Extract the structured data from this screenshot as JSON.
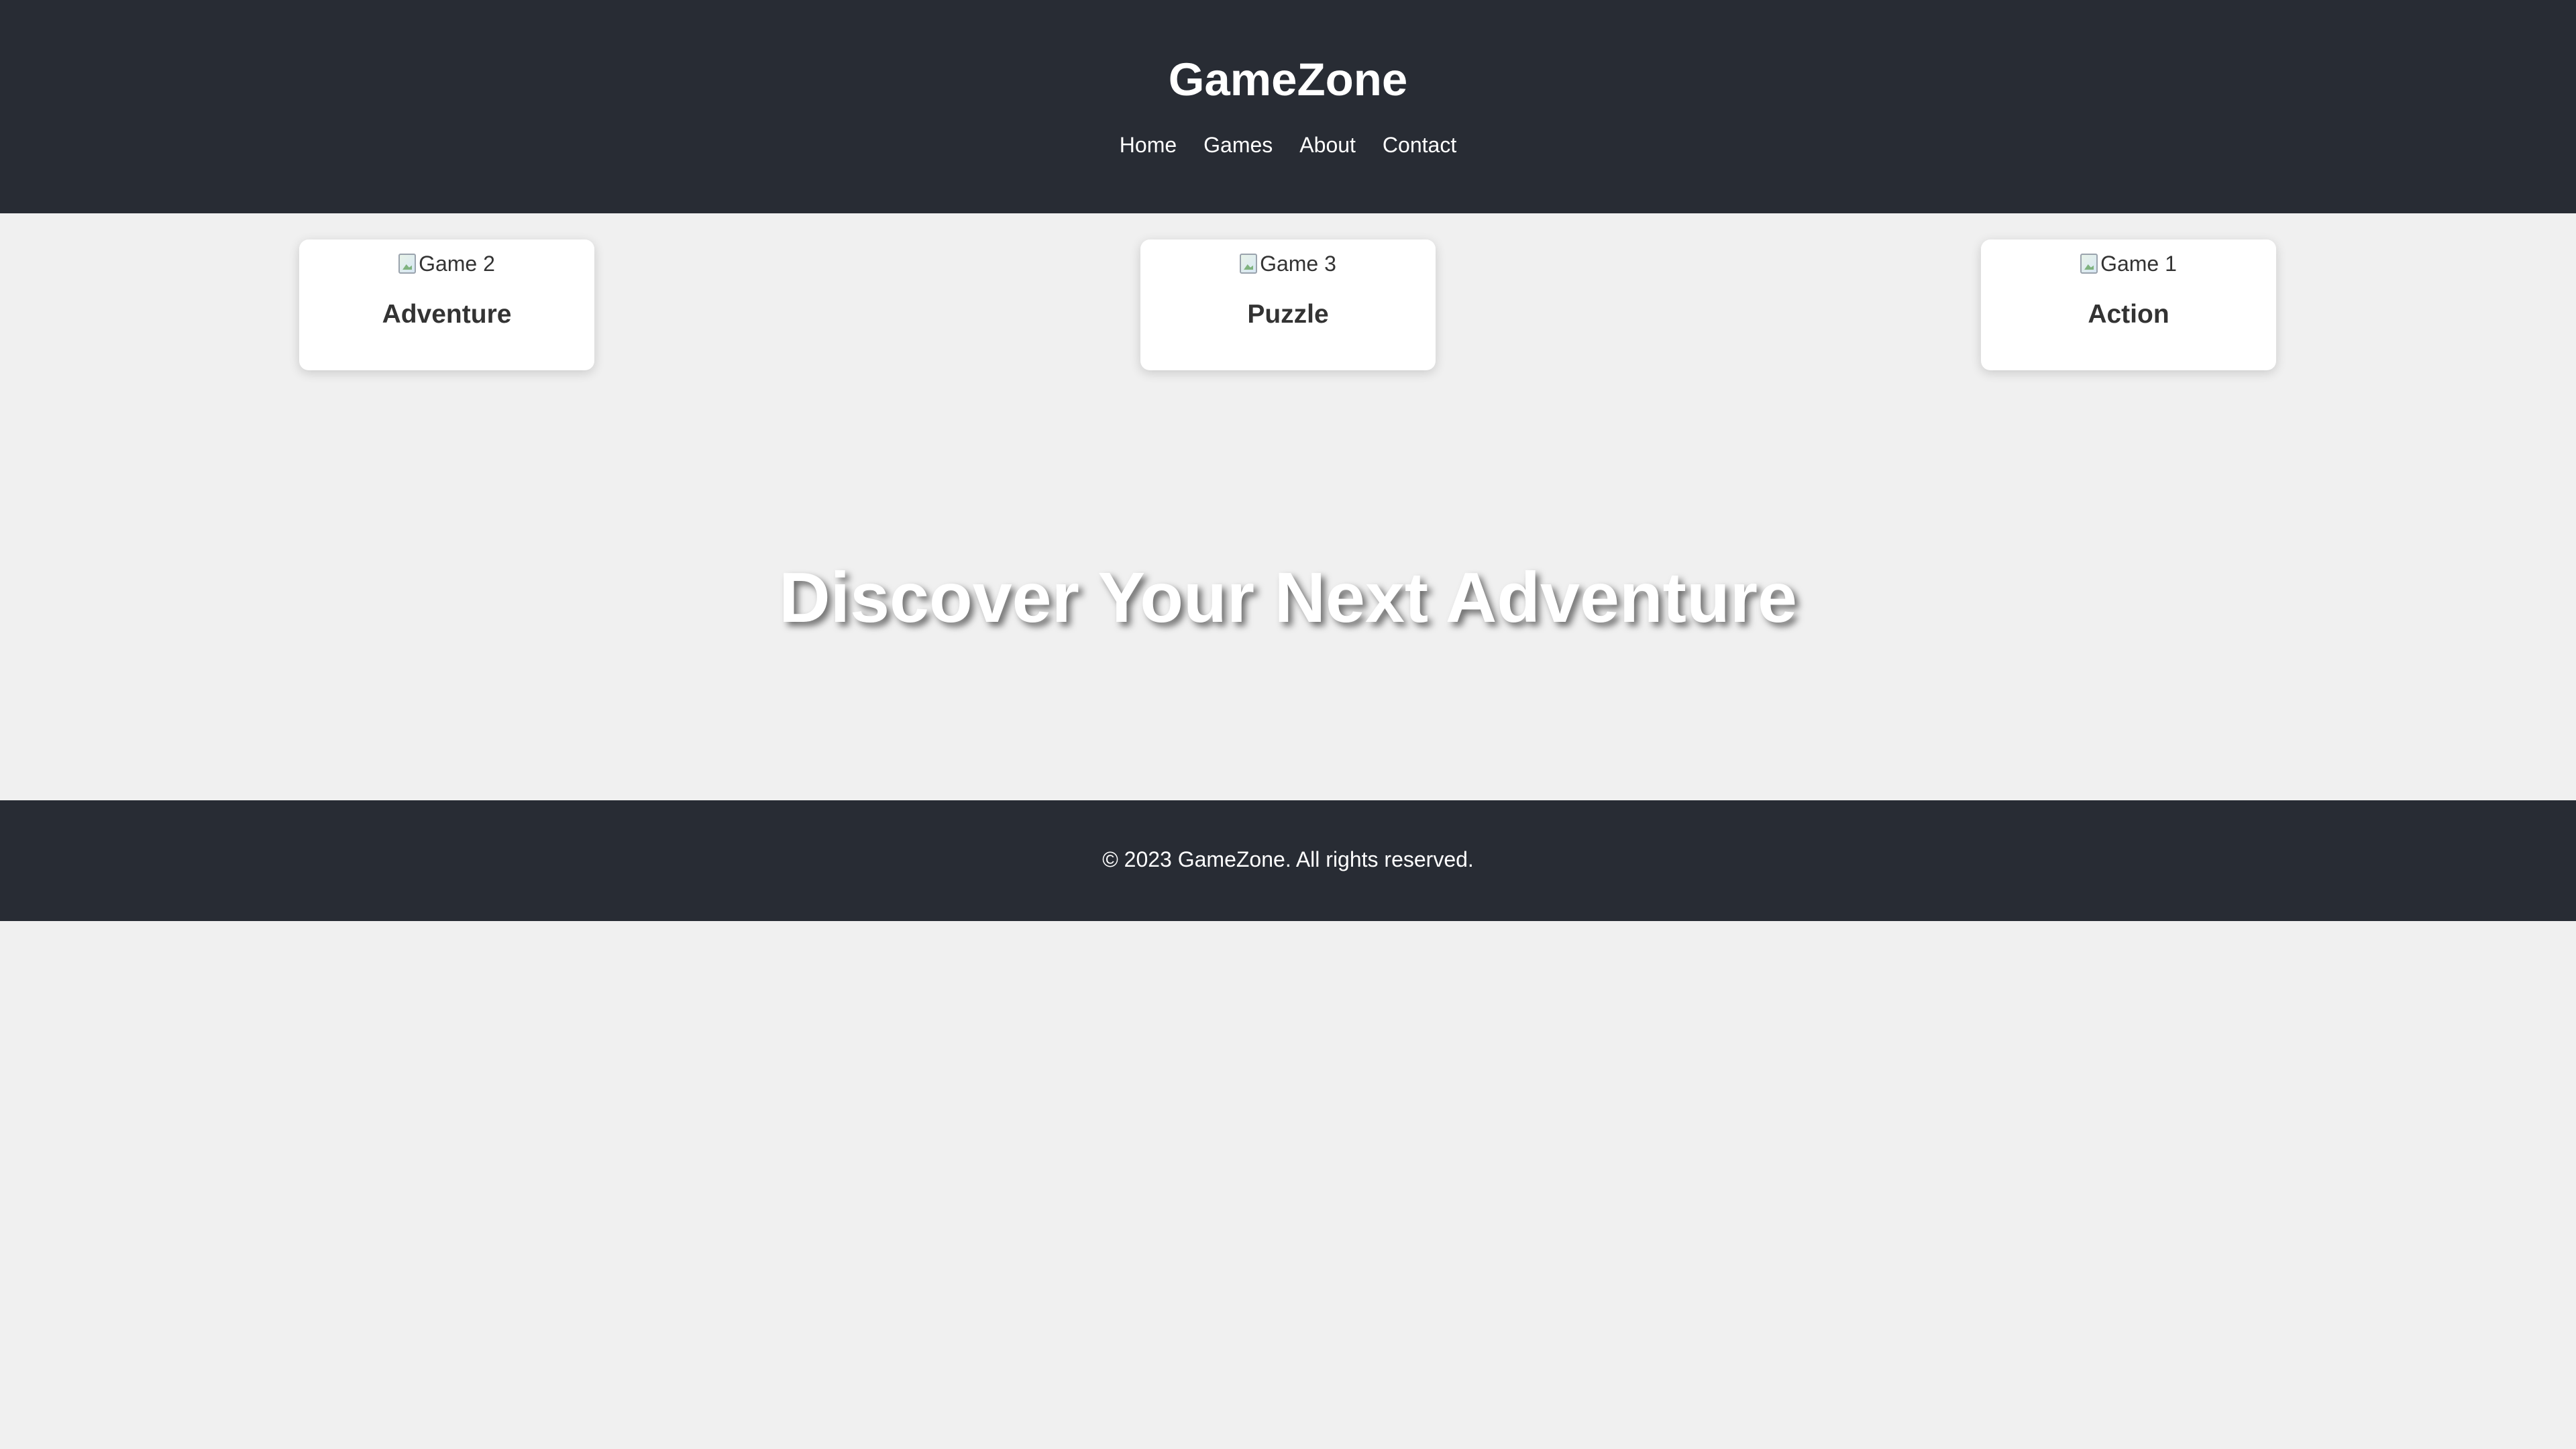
{
  "header": {
    "title": "GameZone",
    "nav": [
      {
        "label": "Home"
      },
      {
        "label": "Games"
      },
      {
        "label": "About"
      },
      {
        "label": "Contact"
      }
    ]
  },
  "games": [
    {
      "image_alt": "Game 2",
      "title": "Adventure"
    },
    {
      "image_alt": "Game 3",
      "title": "Puzzle"
    },
    {
      "image_alt": "Game 1",
      "title": "Action"
    }
  ],
  "hero": {
    "title": "Discover Your Next Adventure"
  },
  "footer": {
    "text": "© 2023 GameZone. All rights reserved."
  },
  "colors": {
    "header_bg": "#282c34",
    "page_bg": "#f0f0f0",
    "card_bg": "#ffffff",
    "text": "#333333",
    "header_text": "#ffffff"
  }
}
